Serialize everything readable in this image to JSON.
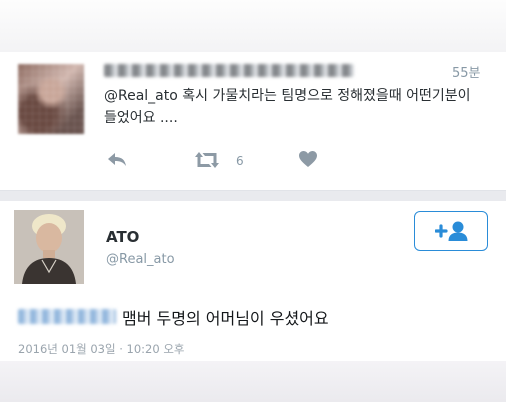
{
  "tweet_reply": {
    "time": "55분",
    "text": "@Real_ato 혹시 가물치라는 팀명으로 정해졌을때 어떤기분이 들었어요 ....",
    "retweet_count": "6",
    "icons": [
      "reply-icon",
      "retweet-icon",
      "heart-icon"
    ]
  },
  "tweet_main": {
    "name": "ATO",
    "handle": "@Real_ato",
    "follow_icon": "follow-user-icon",
    "text": "맴버 두명의 어머님이 우셨어요",
    "timestamp": "2016년 01월 03일 · 10:20 오후"
  },
  "colors": {
    "accent": "#2a8cd8",
    "muted_text": "#8899a6",
    "icon_grey": "#8d9aa5"
  }
}
